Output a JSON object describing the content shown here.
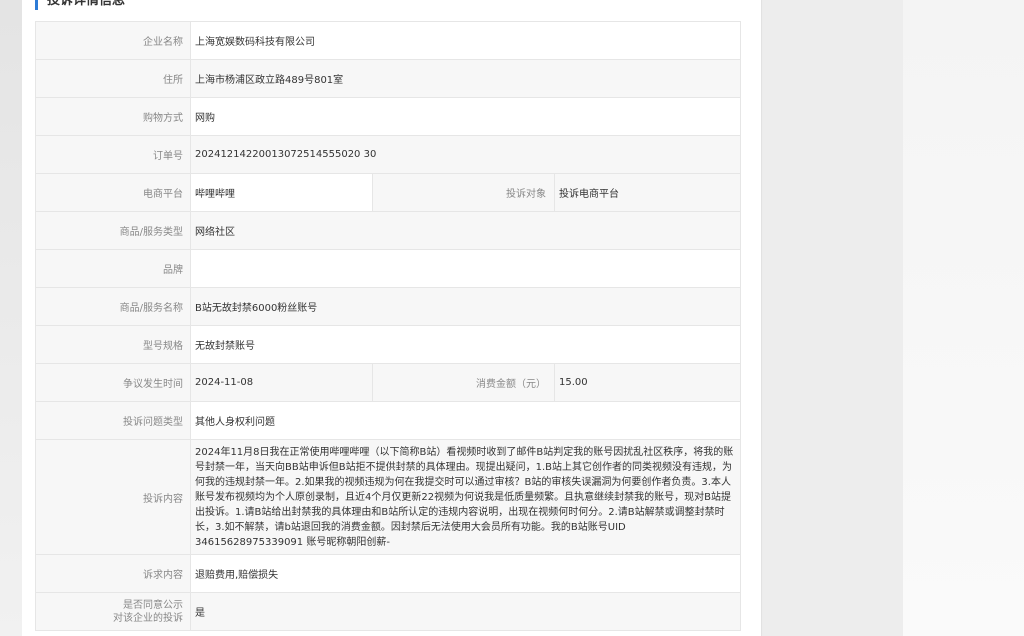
{
  "section_title": "投诉详情信息",
  "rows": {
    "company": {
      "label": "企业名称",
      "value": "上海宽娱数码科技有限公司"
    },
    "address": {
      "label": "住所",
      "value": "上海市杨浦区政立路489号801室"
    },
    "purchase_method": {
      "label": "购物方式",
      "value": "网购"
    },
    "order_no": {
      "label": "订单号",
      "value": "20241214220013072514555020 30"
    },
    "platform": {
      "label": "电商平台",
      "value": "哔哩哔哩"
    },
    "complaint_target": {
      "label": "投诉对象",
      "value": "投诉电商平台"
    },
    "goods_type": {
      "label": "商品/服务类型",
      "value": "网络社区"
    },
    "brand": {
      "label": "品牌",
      "value": ""
    },
    "goods_name": {
      "label": "商品/服务名称",
      "value": "B站无故封禁6000粉丝账号"
    },
    "model_spec": {
      "label": "型号规格",
      "value": "无故封禁账号"
    },
    "dispute_time": {
      "label": "争议发生时间",
      "value": "2024-11-08"
    },
    "amount": {
      "label": "消费金额（元）",
      "value": "15.00"
    },
    "issue_type": {
      "label": "投诉问题类型",
      "value": "其他人身权利问题"
    },
    "content": {
      "label": "投诉内容",
      "value": "2024年11月8日我在正常使用哔哩哔哩（以下简称B站）看视频时收到了邮件B站判定我的账号因扰乱社区秩序，将我的账号封禁一年，当天向BB站申诉但B站拒不提供封禁的具体理由。现提出疑问，1.B站上其它创作者的同类视频没有违规，为何我的违规封禁一年。2.如果我的视频违规为何在我提交时可以通过审核？B站的审核失误漏洞为何要创作者负责。3.本人账号发布视频均为个人原创录制，且近4个月仅更新22视频为何说我是低质量频繁。且执意继续封禁我的账号，现对B站提出投诉。1.请B站给出封禁我的具体理由和B站所认定的违规内容说明，出现在视频何时何分。2.请B站解禁或调整封禁时长，3.如不解禁，请b站退回我的消费金额。因封禁后无法使用大会员所有功能。我的B站账号UID 34615628975339091 账号昵称朝阳创薪-"
    },
    "appeal": {
      "label": "诉求内容",
      "value": "退赔费用,赔偿损失"
    },
    "publish_line1": "是否同意公示",
    "publish_line2": "对该企业的投诉",
    "publish_value": "是"
  }
}
